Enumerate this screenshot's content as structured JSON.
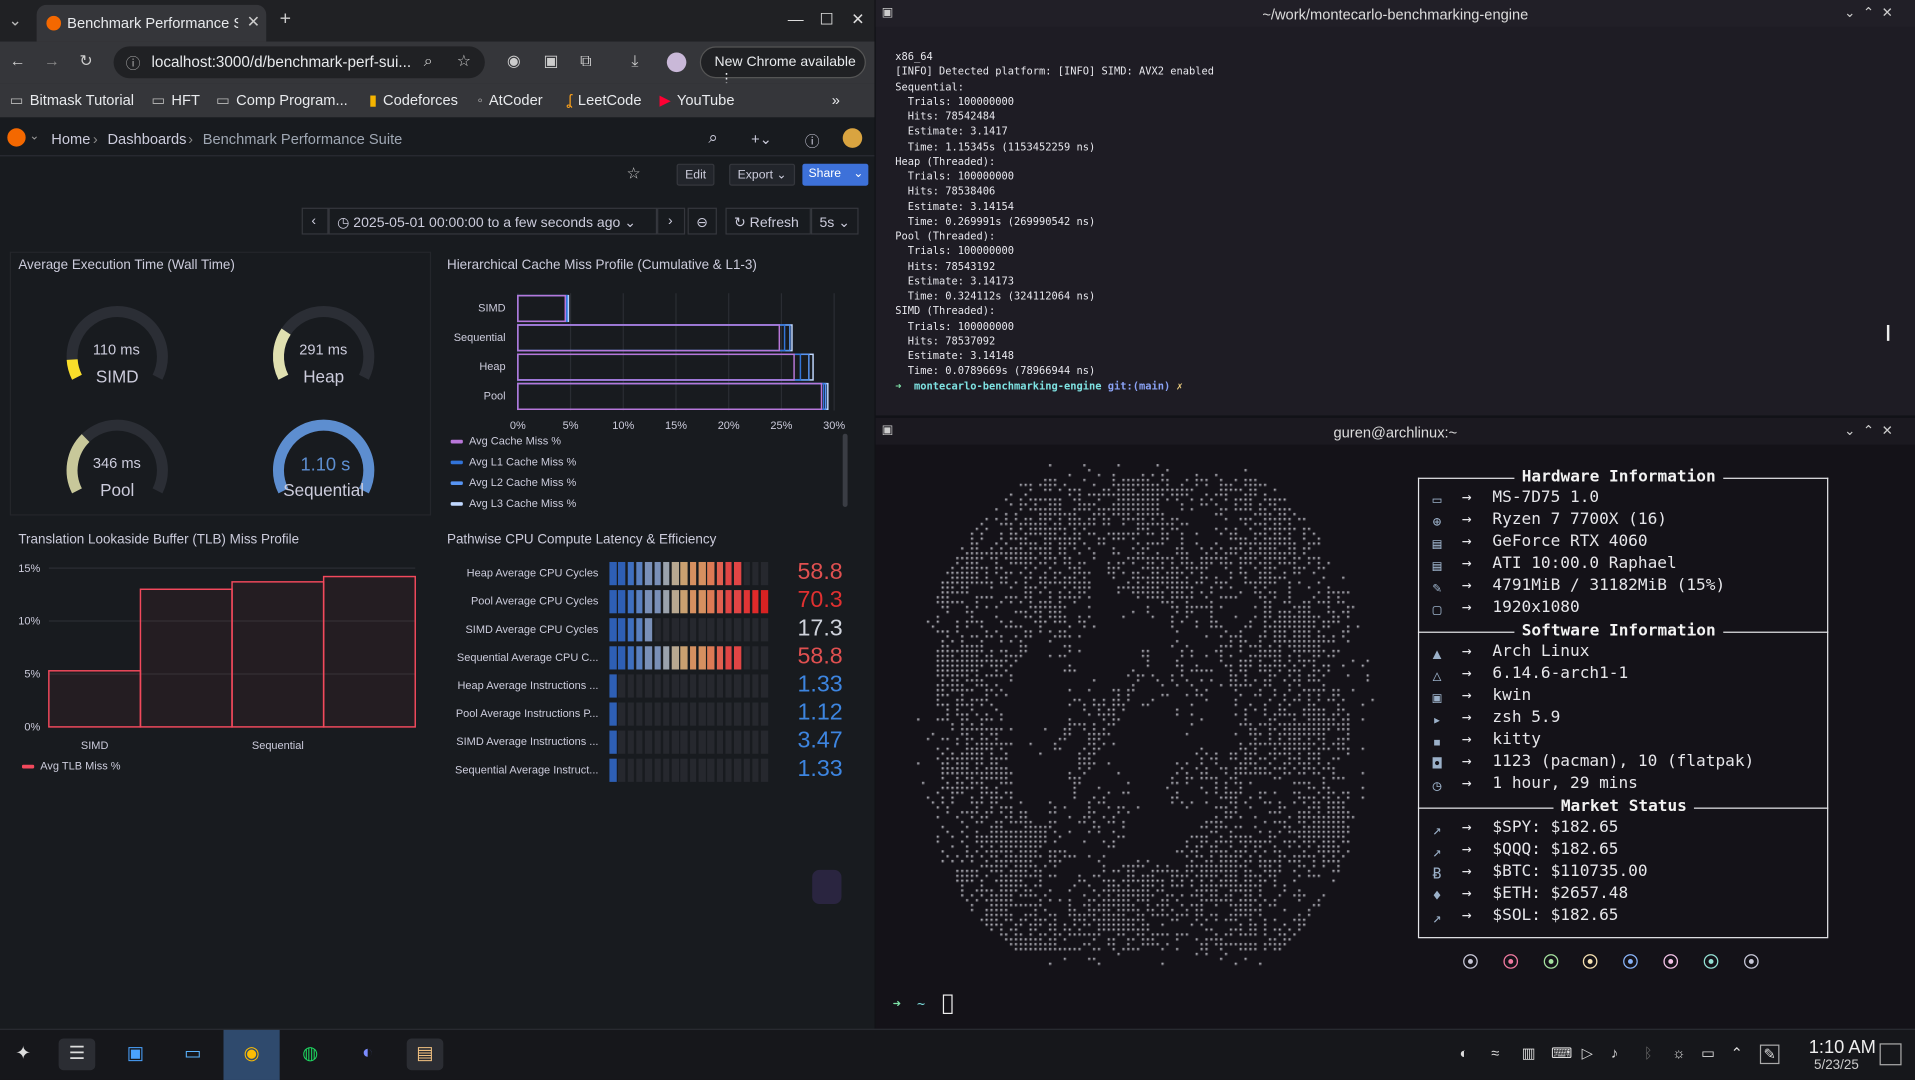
{
  "browser": {
    "tab_title": "Benchmark Performance Suite",
    "url": "localhost:3000/d/benchmark-perf-sui...",
    "update_button": "New Chrome available",
    "bookmarks": [
      "Bitmask Tutorial",
      "HFT",
      "Comp Program...",
      "Codeforces",
      "AtCoder",
      "LeetCode",
      "YouTube"
    ]
  },
  "grafana": {
    "breadcrumbs": [
      "Home",
      "Dashboards",
      "Benchmark Performance Suite"
    ],
    "toolbar": {
      "edit": "Edit",
      "export": "Export",
      "share": "Share"
    },
    "time_range": "2025-05-01 00:00:00 to a few seconds ago",
    "refresh_label": "Refresh",
    "refresh_interval": "5s",
    "gauges_panel": {
      "title": "Average Execution Time (Wall Time)",
      "gauges": [
        {
          "name": "SIMD",
          "value": "110 ms",
          "fraction": 0.1,
          "color": "#fade2a"
        },
        {
          "name": "Heap",
          "value": "291 ms",
          "fraction": 0.26,
          "color": "#e0e0b0"
        },
        {
          "name": "Pool",
          "value": "346 ms",
          "fraction": 0.31,
          "color": "#c8c89a"
        },
        {
          "name": "Sequential",
          "value": "1.10 s",
          "fraction": 1.0,
          "color": "#5d8ed0"
        }
      ]
    },
    "cache_panel": {
      "title": "Hierarchical Cache Miss Profile (Cumulative & L1-3)",
      "legend": [
        "Avg Cache Miss %",
        "Avg L1 Cache Miss %",
        "Avg L2 Cache Miss %",
        "Avg L3 Cache Miss %"
      ]
    },
    "tlb_panel": {
      "title": "Translation Lookaside Buffer (TLB) Miss Profile",
      "legend": "Avg TLB Miss %"
    },
    "cpu_panel": {
      "title": "Pathwise CPU Compute Latency & Efficiency",
      "rows": [
        {
          "label": "Heap Average CPU Cycles",
          "value": "58.8",
          "fraction": 0.84,
          "color": "#e05050"
        },
        {
          "label": "Pool Average CPU Cycles",
          "value": "70.3",
          "fraction": 1.0,
          "color": "#e03030"
        },
        {
          "label": "SIMD Average CPU Cycles",
          "value": "17.3",
          "fraction": 0.25,
          "color": "#cfd3dc"
        },
        {
          "label": "Sequential Average CPU C...",
          "value": "58.8",
          "fraction": 0.84,
          "color": "#e05050"
        },
        {
          "label": "Heap Average Instructions ...",
          "value": "1.33",
          "fraction": 0.05,
          "color": "#3d85e0"
        },
        {
          "label": "Pool Average Instructions P...",
          "value": "1.12",
          "fraction": 0.04,
          "color": "#3d85e0"
        },
        {
          "label": "SIMD Average Instructions ...",
          "value": "3.47",
          "fraction": 0.06,
          "color": "#3d85e0"
        },
        {
          "label": "Sequential Average Instruct...",
          "value": "1.33",
          "fraction": 0.05,
          "color": "#3d85e0"
        }
      ]
    }
  },
  "chart_data": [
    {
      "type": "bar",
      "orientation": "horizontal",
      "title": "Hierarchical Cache Miss Profile (Cumulative & L1-3)",
      "categories": [
        "SIMD",
        "Sequential",
        "Heap",
        "Pool"
      ],
      "series": [
        {
          "name": "Avg Cache Miss %",
          "values": [
            4.5,
            24.8,
            26.2,
            28.8
          ],
          "color": "#b877d9"
        },
        {
          "name": "Avg L1 Cache Miss %",
          "values": [
            4.6,
            25.3,
            26.8,
            29.0
          ],
          "color": "#3274d9"
        },
        {
          "name": "Avg L2 Cache Miss %",
          "values": [
            4.7,
            25.8,
            27.6,
            29.2
          ],
          "color": "#5794f2"
        },
        {
          "name": "Avg L3 Cache Miss %",
          "values": [
            4.8,
            26.0,
            28.0,
            29.4
          ],
          "color": "#c0d8ff"
        }
      ],
      "xticks": [
        "0%",
        "5%",
        "10%",
        "15%",
        "20%",
        "25%",
        "30%"
      ],
      "xlim": [
        0,
        30
      ]
    },
    {
      "type": "bar",
      "title": "Translation Lookaside Buffer (TLB) Miss Profile",
      "categories": [
        "SIMD",
        "",
        "Sequential",
        ""
      ],
      "series": [
        {
          "name": "Avg TLB Miss %",
          "values": [
            5.3,
            13.0,
            13.7,
            14.2
          ],
          "color": "#f2495c"
        }
      ],
      "yticks": [
        "0%",
        "5%",
        "10%",
        "15%"
      ],
      "ylim": [
        0,
        15
      ]
    }
  ],
  "terminal1": {
    "title": "~/work/montecarlo-benchmarking-engine",
    "lines": [
      "x86_64",
      "[INFO] Detected platform: [INFO] SIMD: AVX2 enabled",
      "Sequential:",
      "  Trials: 100000000",
      "  Hits: 78542484",
      "  Estimate: 3.1417",
      "  Time: 1.15345s (1153452259 ns)",
      "Heap (Threaded):",
      "  Trials: 100000000",
      "  Hits: 78538406",
      "  Estimate: 3.14154",
      "  Time: 0.269991s (269990542 ns)",
      "Pool (Threaded):",
      "  Trials: 100000000",
      "  Hits: 78543192",
      "  Estimate: 3.14173",
      "  Time: 0.324112s (324112064 ns)",
      "SIMD (Threaded):",
      "  Trials: 100000000",
      "  Hits: 78537092",
      "  Estimate: 3.14148",
      "  Time: 0.0789669s (78966944 ns)"
    ],
    "prompt_dir": "montecarlo-benchmarking-engine",
    "prompt_git": "git:(main)",
    "prompt_mark": "✗"
  },
  "terminal2": {
    "title": "guren@archlinux:~",
    "hardware_header": "Hardware Information",
    "hardware": [
      {
        "icon": "laptop-icon",
        "glyph": "▭",
        "text": "MS-7D75 1.0"
      },
      {
        "icon": "cpu-icon",
        "glyph": "⊕",
        "text": "Ryzen 7 7700X (16)"
      },
      {
        "icon": "gpu-icon",
        "glyph": "▤",
        "text": "GeForce RTX 4060"
      },
      {
        "icon": "gpu-icon",
        "glyph": "▤",
        "text": "ATI 10:00.0 Raphael"
      },
      {
        "icon": "memory-icon",
        "glyph": "✎",
        "text": "4791MiB / 31182MiB (15%)"
      },
      {
        "icon": "display-icon",
        "glyph": "▢",
        "text": "1920x1080"
      }
    ],
    "software_header": "Software Information",
    "software": [
      {
        "icon": "arch-icon",
        "glyph": "▲",
        "text": "Arch Linux"
      },
      {
        "icon": "kernel-icon",
        "glyph": "△",
        "text": "6.14.6-arch1-1"
      },
      {
        "icon": "wm-icon",
        "glyph": "▣",
        "text": "kwin"
      },
      {
        "icon": "shell-icon",
        "glyph": "▸",
        "text": "zsh 5.9"
      },
      {
        "icon": "terminal-icon",
        "glyph": "▪",
        "text": "kitty"
      },
      {
        "icon": "package-icon",
        "glyph": "◘",
        "text": "1123 (pacman), 10 (flatpak)"
      },
      {
        "icon": "clock-icon",
        "glyph": "◷",
        "text": "1 hour, 29 mins"
      }
    ],
    "market_header": "Market Status",
    "market": [
      {
        "icon": "chart-icon",
        "glyph": "↗",
        "text": "$SPY: $182.65"
      },
      {
        "icon": "chart-icon",
        "glyph": "↗",
        "text": "$QQQ: $182.65"
      },
      {
        "icon": "bitcoin-icon",
        "glyph": "Ƀ",
        "text": "$BTC: $110735.00"
      },
      {
        "icon": "ethereum-icon",
        "glyph": "♦",
        "text": "$ETH: $2657.48"
      },
      {
        "icon": "chart-icon",
        "glyph": "↗",
        "text": "$SOL: $182.65"
      }
    ],
    "dot_colors": [
      "#c8c8d8",
      "#f07aa0",
      "#a6e3a1",
      "#f9e2af",
      "#89b4fa",
      "#f5c2e7",
      "#94e2d5",
      "#c8c8d8"
    ],
    "prompt": "~"
  },
  "taskbar": {
    "time": "1:10 AM",
    "date": "5/23/25"
  }
}
